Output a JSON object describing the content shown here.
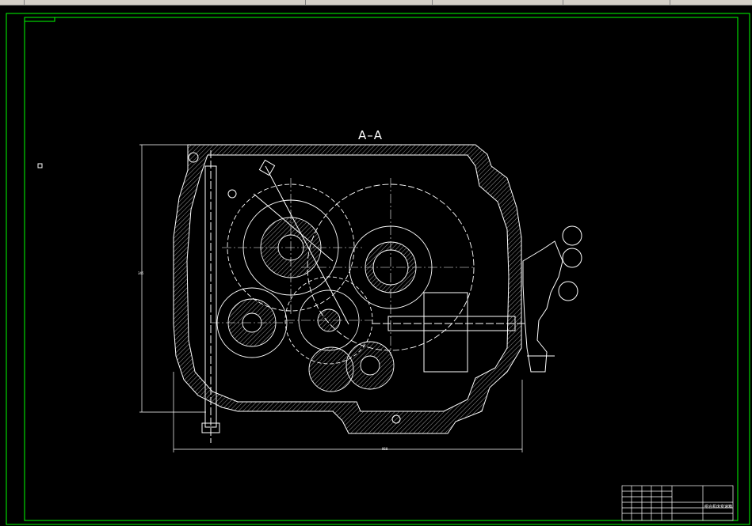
{
  "section_label": "A–A",
  "dimensions": {
    "height_dim": "345",
    "width_dim": "860"
  },
  "title_block": {
    "title": "组合机床变速箱"
  },
  "colors": {
    "background": "#000000",
    "line": "#ffffff",
    "frame": "#00ff00",
    "toolbar": "#d4d0c8"
  }
}
